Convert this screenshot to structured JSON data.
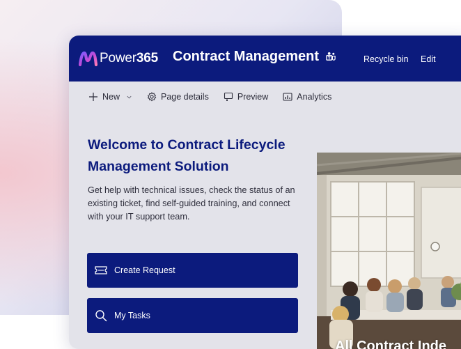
{
  "brand": {
    "name_regular": "Power",
    "name_bold": "365"
  },
  "site": {
    "title": "Contract Management",
    "links": {
      "recycle_bin": "Recycle bin",
      "edit": "Edit"
    }
  },
  "commands": {
    "new": "New",
    "page_details": "Page details",
    "preview": "Preview",
    "analytics": "Analytics"
  },
  "hero": {
    "title_line1": "Welcome to Contract Lifecycle",
    "title_line2": "Management Solution",
    "description": "Get help with technical issues, check the status of an existing ticket, find self-guided training, and connect with your IT support team."
  },
  "actions": {
    "create_request": "Create Request",
    "my_tasks": "My Tasks"
  },
  "image_card": {
    "caption": "All Contract Inde"
  },
  "colors": {
    "primary": "#0c1b7d",
    "background": "#e3e3ea"
  }
}
